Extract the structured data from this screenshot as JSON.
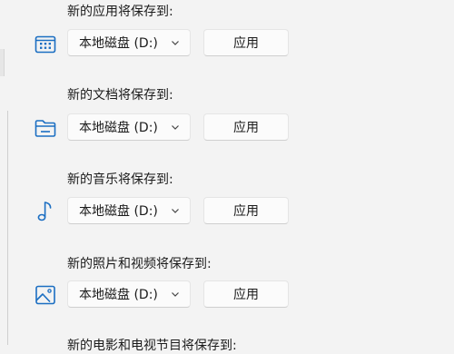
{
  "sections": [
    {
      "label": "新的应用将保存到:",
      "icon": "app-icon",
      "drive": "本地磁盘 (D:)",
      "apply": "应用"
    },
    {
      "label": "新的文档将保存到:",
      "icon": "folder-icon",
      "drive": "本地磁盘 (D:)",
      "apply": "应用"
    },
    {
      "label": "新的音乐将保存到:",
      "icon": "music-note-icon",
      "drive": "本地磁盘 (D:)",
      "apply": "应用"
    },
    {
      "label": "新的照片和视频将保存到:",
      "icon": "image-icon",
      "drive": "本地磁盘 (D:)",
      "apply": "应用"
    },
    {
      "label": "新的电影和电视节目将保存到:"
    }
  ],
  "colors": {
    "accent": "#1b6ec2",
    "background": "#f3f3f3",
    "control": "#fbfbfb"
  }
}
